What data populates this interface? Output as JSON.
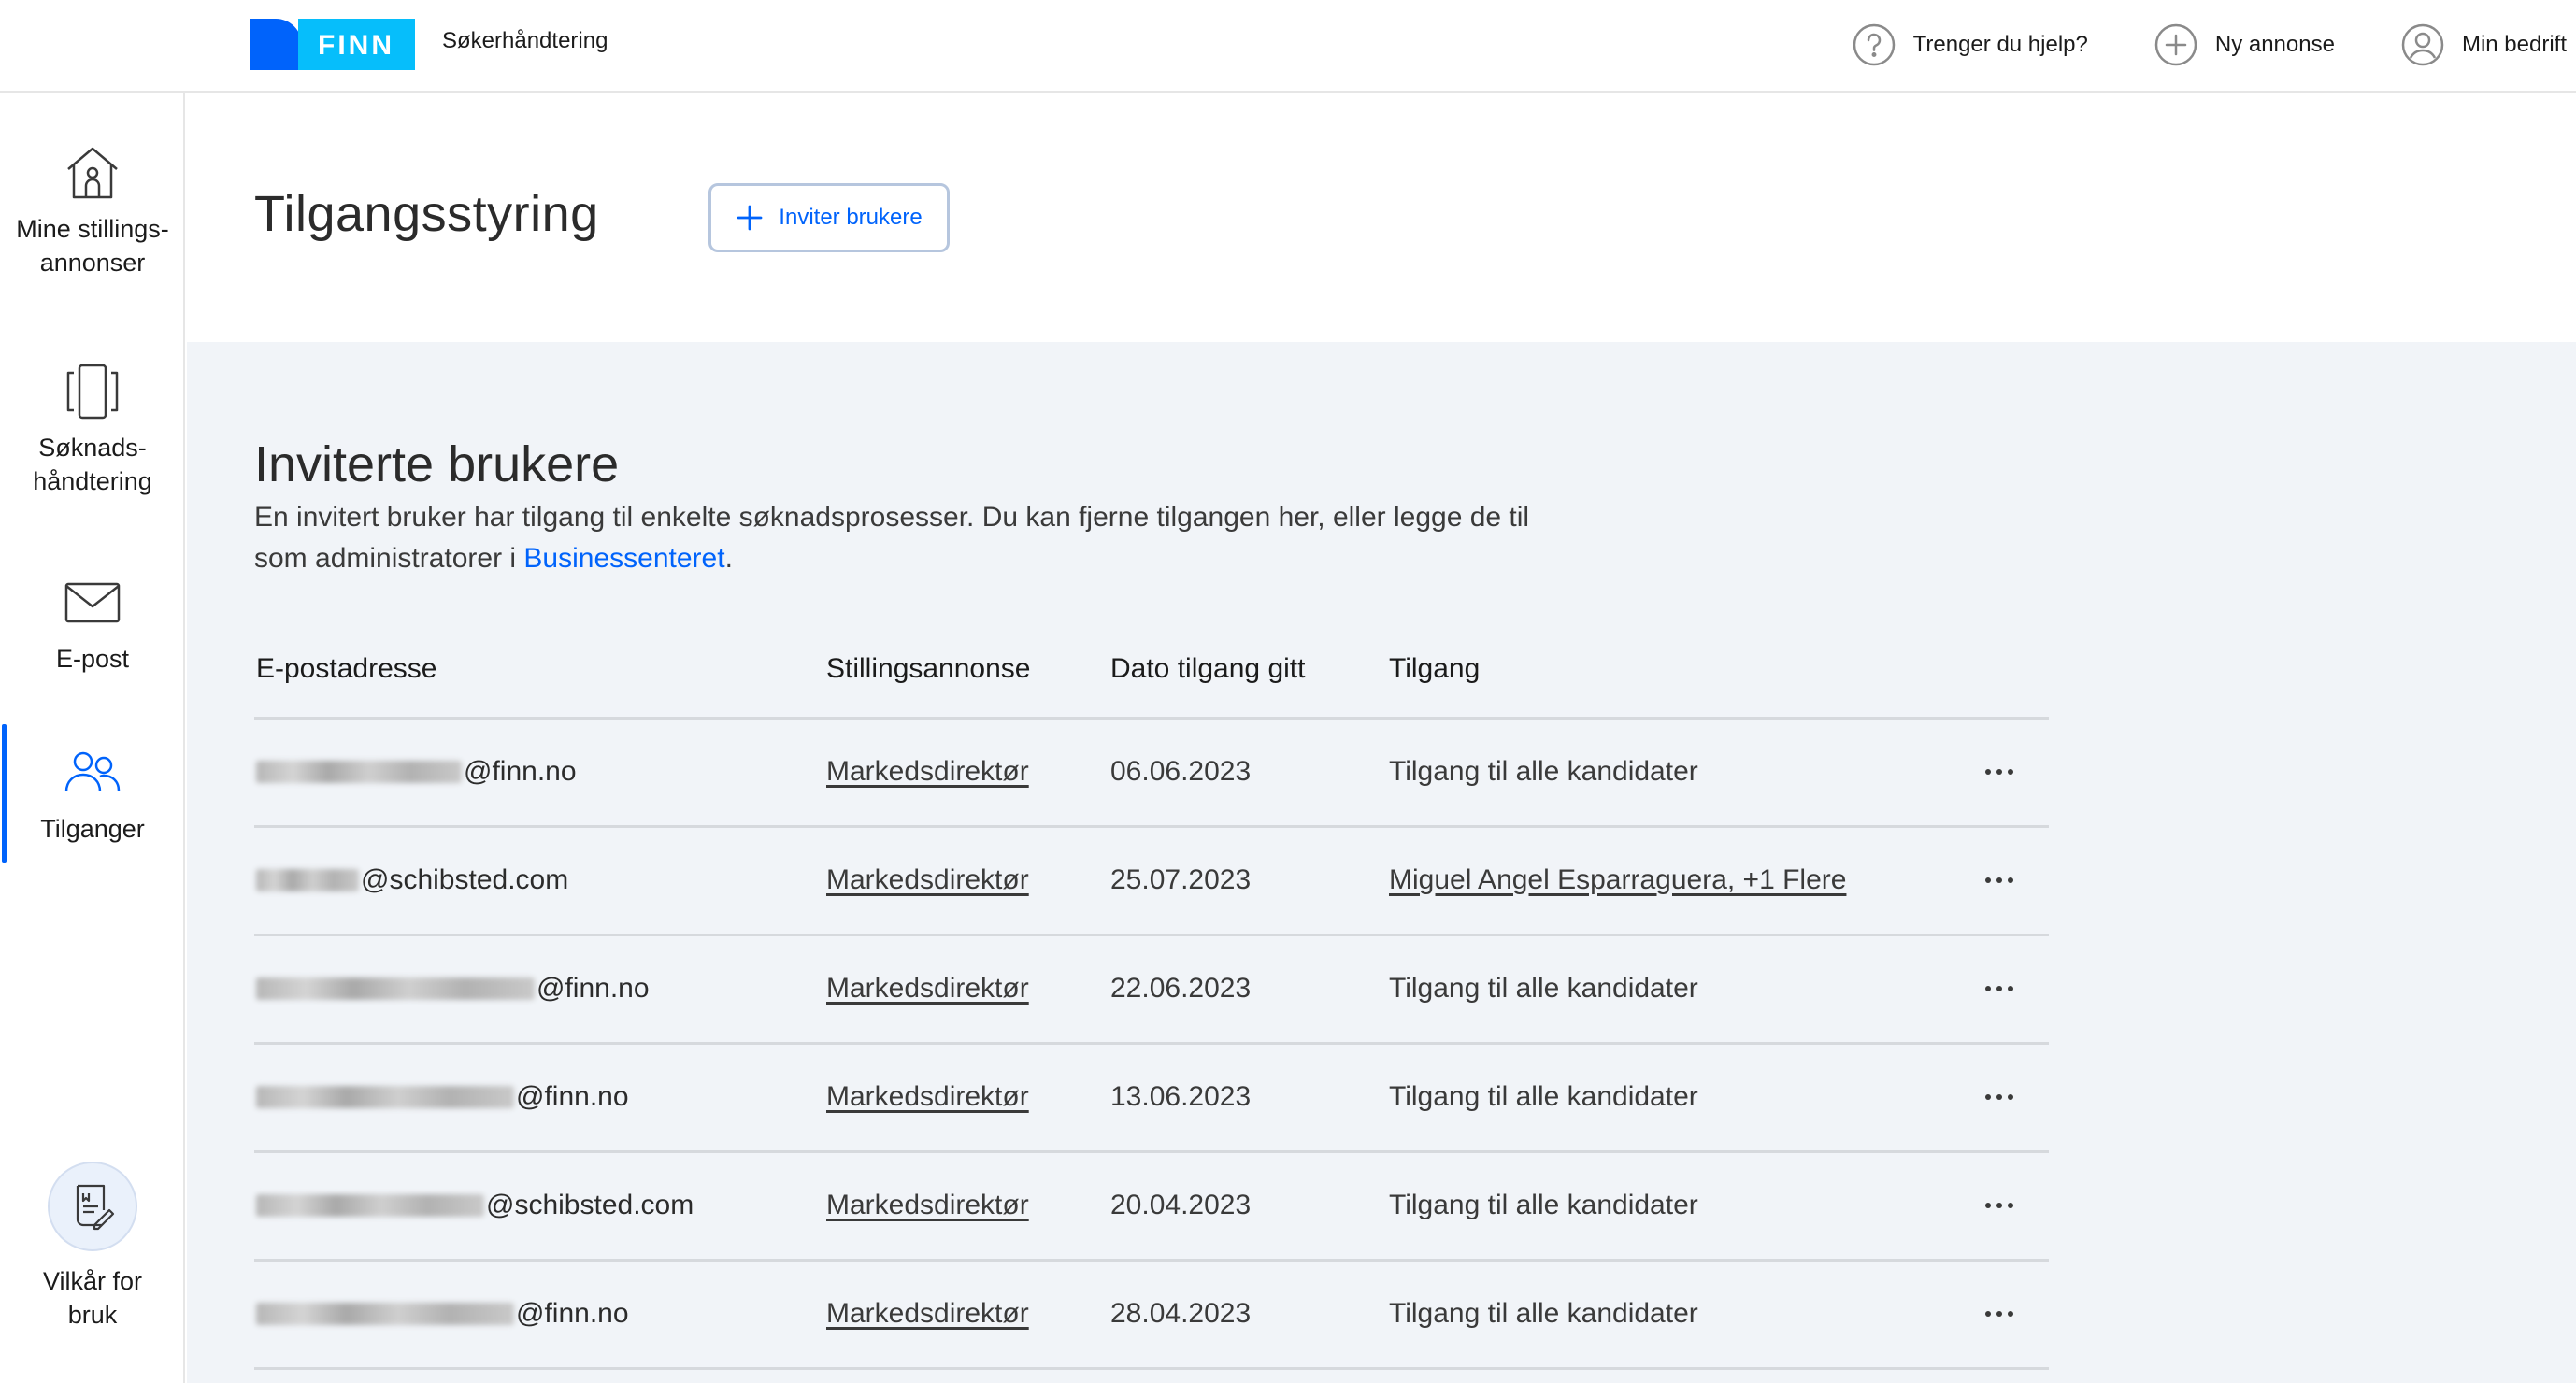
{
  "header": {
    "logo_text": "FINN",
    "app_name": "Søkerhåndtering",
    "help_label": "Trenger du hjelp?",
    "new_ad_label": "Ny annonse",
    "company_label": "Min bedrift"
  },
  "sidebar": {
    "items": [
      {
        "label": "Mine stillings-annonser",
        "icon": "house-user-icon"
      },
      {
        "label": "Søknads-håndtering",
        "icon": "cards-icon"
      },
      {
        "label": "E-post",
        "icon": "envelope-icon"
      },
      {
        "label": "Tilganger",
        "icon": "users-icon",
        "active": true
      }
    ],
    "terms_label": "Vilkår for bruk"
  },
  "page": {
    "title": "Tilgangsstyring",
    "invite_button": "Inviter brukere"
  },
  "section": {
    "title": "Inviterte brukere",
    "description": "En invitert bruker har tilgang til enkelte søknadsprosesser. Du kan fjerne tilgangen her, eller legge de til som administratorer i ",
    "link_text": "Businessenteret",
    "description_end": "."
  },
  "table": {
    "headers": [
      "E-postadresse",
      "Stillingsannonse",
      "Dato tilgang gitt",
      "Tilgang"
    ],
    "rows": [
      {
        "email_domain": "@finn.no",
        "job": "Markedsdirektør",
        "date": "06.06.2023",
        "access": "Tilgang til alle kandidater",
        "access_is_link": false
      },
      {
        "email_domain": "@schibsted.com",
        "job": "Markedsdirektør",
        "date": "25.07.2023",
        "access": "Miguel Angel Esparraguera, +1 Flere",
        "access_is_link": true
      },
      {
        "email_domain": "@finn.no",
        "job": "Markedsdirektør",
        "date": "22.06.2023",
        "access": "Tilgang til alle kandidater",
        "access_is_link": false
      },
      {
        "email_domain": "@finn.no",
        "job": "Markedsdirektør",
        "date": "13.06.2023",
        "access": "Tilgang til alle kandidater",
        "access_is_link": false
      },
      {
        "email_domain": "@schibsted.com",
        "job": "Markedsdirektør",
        "date": "20.04.2023",
        "access": "Tilgang til alle kandidater",
        "access_is_link": false
      },
      {
        "email_domain": "@finn.no",
        "job": "Markedsdirektør",
        "date": "28.04.2023",
        "access": "Tilgang til alle kandidater",
        "access_is_link": false
      }
    ]
  },
  "colors": {
    "brand_blue": "#0063fb",
    "section_bg": "#f1f4f8"
  }
}
